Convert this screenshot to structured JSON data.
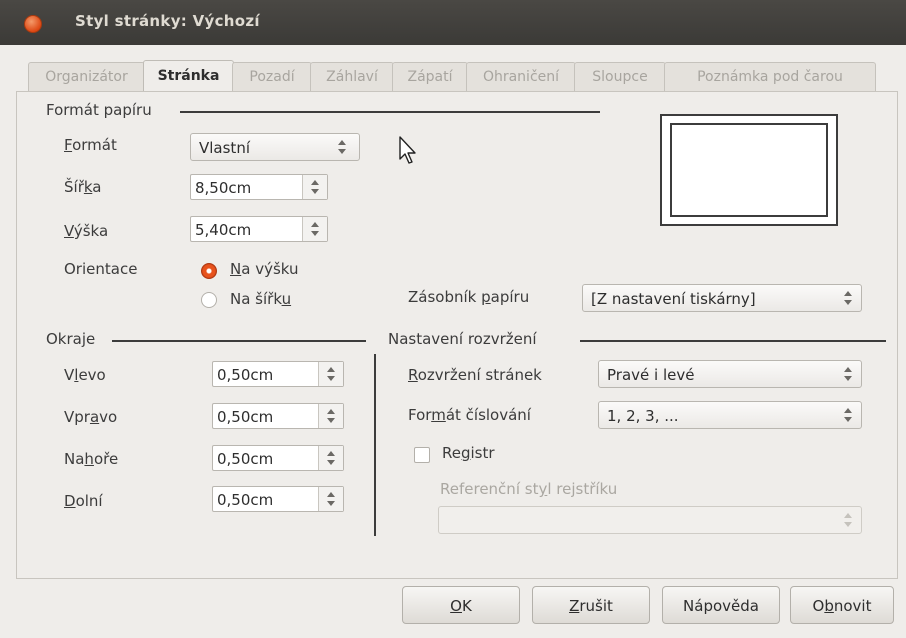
{
  "window": {
    "title": "Styl stránky: Výchozí"
  },
  "tabs": [
    "Organizátor",
    "Stránka",
    "Pozadí",
    "Záhlaví",
    "Zápatí",
    "Ohraničení",
    "Sloupce",
    "Poznámka pod čarou"
  ],
  "paper": {
    "group_title": "Formát papíru",
    "format_label": "Formát",
    "format_value": "Vlastní",
    "width_label": "Šířka",
    "width_value": "8,50cm",
    "height_label": "Výška",
    "height_value": "5,40cm",
    "orientation_label": "Orientace",
    "portrait_label": "Na výšku",
    "landscape_label": "Na šířku",
    "tray_label": "Zásobník papíru",
    "tray_value": "[Z nastavení tiskárny]"
  },
  "margins": {
    "group_title": "Okraje",
    "left_label": "Vlevo",
    "left_value": "0,50cm",
    "right_label": "Vpravo",
    "right_value": "0,50cm",
    "top_label": "Nahoře",
    "top_value": "0,50cm",
    "bottom_label": "Dolní",
    "bottom_value": "0,50cm"
  },
  "layout": {
    "group_title": "Nastavení rozvržení",
    "page_layout_label": "Rozvržení stránek",
    "page_layout_value": "Pravé i levé",
    "numbering_label": "Formát číslování",
    "numbering_value": "1, 2, 3, ...",
    "register_label": "Registr",
    "reference_style_label": "Referenční styl rejstříku",
    "reference_style_value": ""
  },
  "buttons": {
    "ok": "OK",
    "cancel": "Zrušit",
    "help": "Nápověda",
    "reset": "Obnovit"
  },
  "state": {
    "orientation": "portrait",
    "register_checked": false
  }
}
